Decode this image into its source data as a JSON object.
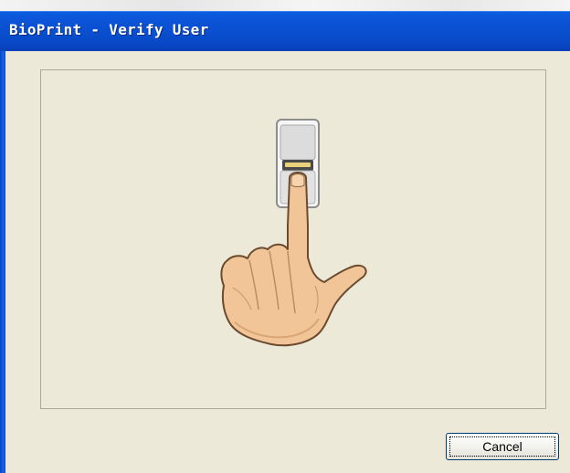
{
  "window": {
    "title": "BioPrint - Verify User"
  },
  "illustration": {
    "icon": "finger-on-scanner-icon",
    "skin_color": "#f2c598",
    "outline_color": "#7a5a3a",
    "scanner_color": "#d8d8d8"
  },
  "buttons": {
    "cancel_label": "Cancel"
  },
  "colors": {
    "title_bar": "#0a55d8",
    "face": "#ece9d8"
  }
}
